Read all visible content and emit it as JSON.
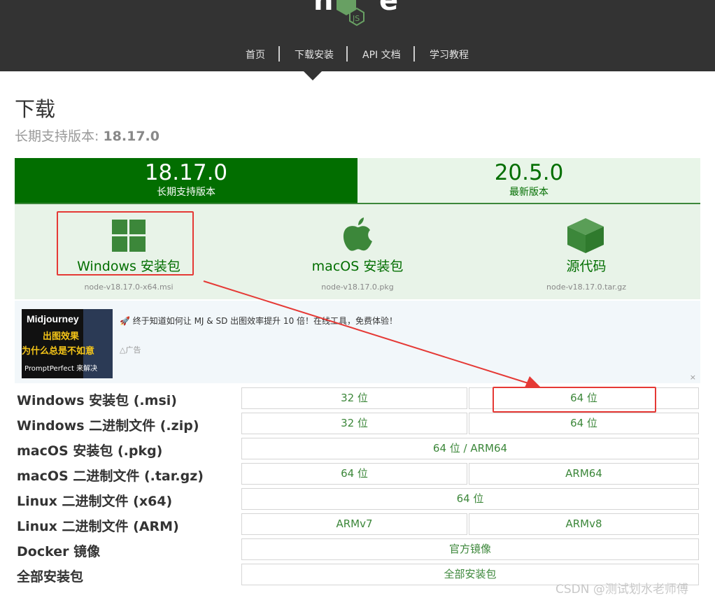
{
  "nav": {
    "items": [
      "首页",
      "下载安装",
      "API 文档",
      "学习教程"
    ]
  },
  "page": {
    "title": "下载",
    "lts_prefix": "长期支持版本: ",
    "lts_version": "18.17.0"
  },
  "tabs": [
    {
      "version": "18.17.0",
      "label": "长期支持版本"
    },
    {
      "version": "20.5.0",
      "label": "最新版本"
    }
  ],
  "downloads": [
    {
      "label": "Windows 安装包",
      "file": "node-v18.17.0-x64.msi",
      "icon": "windows-icon"
    },
    {
      "label": "macOS 安装包",
      "file": "node-v18.17.0.pkg",
      "icon": "apple-icon"
    },
    {
      "label": "源代码",
      "file": "node-v18.17.0.tar.gz",
      "icon": "box-icon"
    }
  ],
  "ad": {
    "image_title": "Midjourney",
    "image_line1": "出图效果",
    "image_line2": "为什么总是不如意",
    "image_footer": "PromptPerfect 来解决",
    "text": "🚀 终于知道如何让 MJ & SD 出图效率提升 10 倍！在线工具，免费体验！",
    "tag": "广告",
    "close": "×"
  },
  "table": [
    {
      "label": "Windows 安装包 (.msi)",
      "cells": [
        "32 位",
        "64 位"
      ]
    },
    {
      "label": "Windows 二进制文件 (.zip)",
      "cells": [
        "32 位",
        "64 位"
      ]
    },
    {
      "label": "macOS 安装包 (.pkg)",
      "cells": [
        "64 位 / ARM64"
      ]
    },
    {
      "label": "macOS 二进制文件 (.tar.gz)",
      "cells": [
        "64 位",
        "ARM64"
      ]
    },
    {
      "label": "Linux 二进制文件 (x64)",
      "cells": [
        "64 位"
      ]
    },
    {
      "label": "Linux 二进制文件 (ARM)",
      "cells": [
        "ARMv7",
        "ARMv8"
      ]
    },
    {
      "label": "Docker 镜像",
      "cells": [
        "官方镜像"
      ]
    },
    {
      "label": "全部安装包",
      "cells": [
        "全部安装包"
      ]
    }
  ],
  "watermark": "CSDN @测试划水老师傅",
  "colors": {
    "header": "#333333",
    "brand_green": "#026e00",
    "link_green": "#3c873a",
    "annotation_red": "#e53935"
  }
}
